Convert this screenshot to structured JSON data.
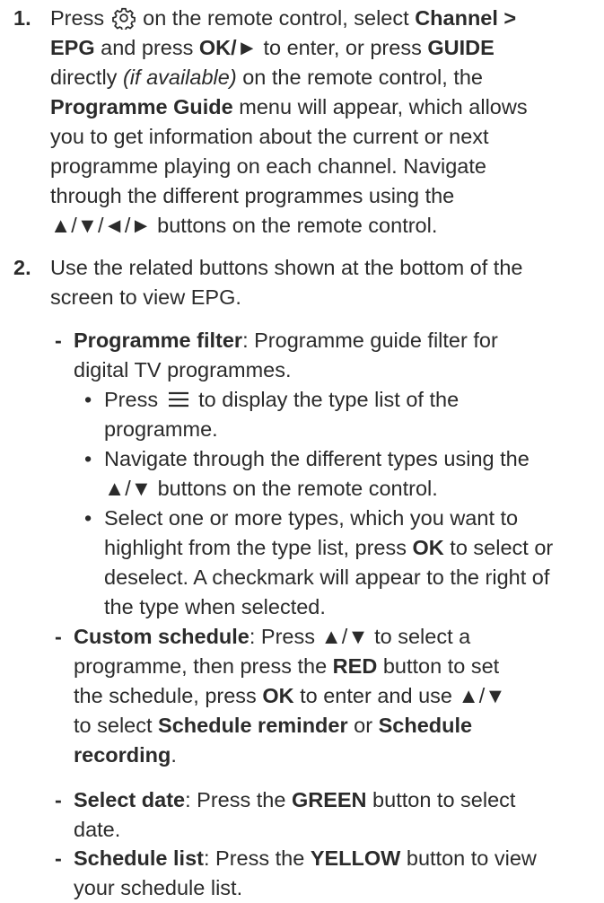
{
  "step1": {
    "number": "1.",
    "l1_a": "Press ",
    "l1_b": " on the remote control, select ",
    "l1_c": "Channel >",
    "l2_a": "EPG",
    "l2_b": " and press ",
    "l2_c": "OK/►",
    "l2_d": " to enter, or press ",
    "l2_e": "GUIDE",
    "l3_a": "directly ",
    "l3_b": "(if available)",
    "l3_c": " on the remote control, the",
    "l4_a": "Programme Guide",
    "l4_b": " menu will appear, which allows",
    "l5": "you to get information about the current or next",
    "l6": "programme playing on each channel. Navigate",
    "l7": "through the different programmes using the",
    "l8": "▲/▼/◄/► buttons on the remote control."
  },
  "step2": {
    "number": "2.",
    "l1": "Use the related buttons shown at the bottom of the",
    "l2": "screen to view EPG.",
    "filter": {
      "dash": "-",
      "label": "Programme filter",
      "l1_rest": ": Programme guide filter for",
      "l2": "digital TV programmes.",
      "bullets": {
        "b1_a": "Press ",
        "b1_b": " to display the type list of the",
        "b1_l2": "programme.",
        "b2_l1": "Navigate through the different types using the",
        "b2_l2": "▲/▼ buttons on the remote control.",
        "b3_l1": "Select one or more types, which you want to",
        "b3_l2_a": "highlight from the type list, press ",
        "b3_l2_b": "OK",
        "b3_l2_c": " to select or",
        "b3_l3": "deselect. A checkmark will appear to the right of",
        "b3_l4": "the type when selected."
      }
    },
    "custom": {
      "dash": "-",
      "label": "Custom schedule",
      "l1_rest": ": Press ▲/▼ to select a",
      "l2_a": "programme, then press the ",
      "l2_b": "RED",
      "l2_c": " button to set",
      "l3_a": "the schedule, press ",
      "l3_b": "OK",
      "l3_c": " to enter and use ▲/▼",
      "l4_a": "to select ",
      "l4_b": "Schedule reminder",
      "l4_c": " or ",
      "l4_d": "Schedule",
      "l5_a": "recording",
      "l5_b": "."
    },
    "date": {
      "dash": "-",
      "label": "Select date",
      "l1_a": ": Press the ",
      "l1_b": "GREEN",
      "l1_c": " button to select",
      "l2": "date."
    },
    "list": {
      "dash": "-",
      "label": "Schedule list",
      "l1_a": ": Press the ",
      "l1_b": "YELLOW",
      "l1_c": " button to view",
      "l2": "your schedule list."
    }
  },
  "bullet_glyph": "•",
  "icons": {
    "settings": "gear-icon",
    "menu": "menu-lines-icon"
  }
}
